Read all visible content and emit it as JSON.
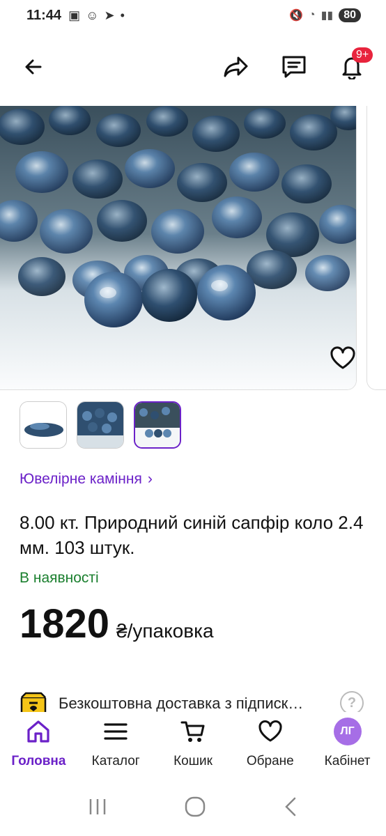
{
  "status_bar": {
    "time": "11:44",
    "battery": "80"
  },
  "header": {
    "notification_badge": "9+"
  },
  "breadcrumb": {
    "category": "Ювелірне каміння",
    "chevron": "›"
  },
  "product": {
    "title": "8.00 кт.  Природний синій сапфір коло 2.4 мм. 103 штук.",
    "availability": "В наявності",
    "price": "1820",
    "price_unit": "₴/упаковка"
  },
  "delivery": {
    "text": "Безкоштовна доставка з підписк…",
    "help": "?"
  },
  "bottom_nav": {
    "items": [
      {
        "label": "Головна",
        "icon": "home-icon",
        "active": true
      },
      {
        "label": "Каталог",
        "icon": "menu-icon"
      },
      {
        "label": "Кошик",
        "icon": "cart-icon"
      },
      {
        "label": "Обране",
        "icon": "heart-icon"
      },
      {
        "label": "Кабінет",
        "icon": "avatar-icon",
        "avatar_text": "ЛГ"
      }
    ]
  },
  "colors": {
    "accent": "#6b21c8",
    "in_stock": "#1a7f2e",
    "badge": "#e8243d",
    "avatar": "#a66ee6"
  }
}
